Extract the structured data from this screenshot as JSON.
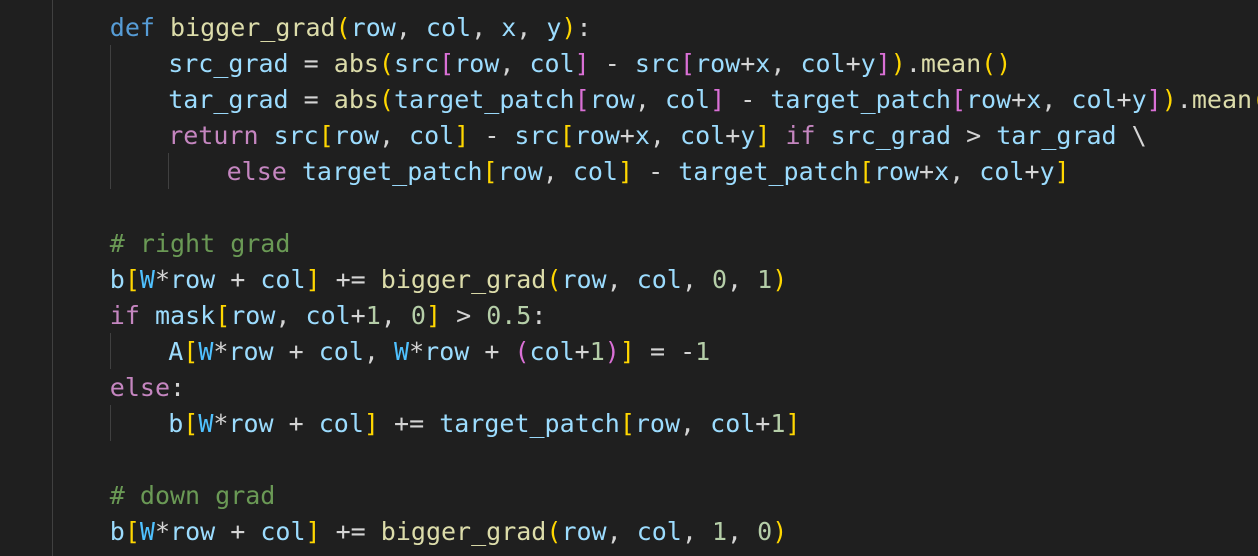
{
  "editor": {
    "language": "python",
    "colors": {
      "background": "#1f1f1f",
      "keyword": "#569cd6",
      "control": "#c586c0",
      "function": "#dcdcaa",
      "variable": "#9cdcfe",
      "constant": "#4fc1ff",
      "number": "#b5cea8",
      "comment": "#6a9955",
      "operator": "#d4d4d4",
      "bracket_1": "#ffd700",
      "bracket_2": "#da70d6",
      "bracket_3": "#179fff"
    },
    "lines": [
      {
        "indent": 2,
        "tokens": [
          [
            "keyword",
            "def"
          ],
          [
            "op",
            " "
          ],
          [
            "func",
            "bigger_grad"
          ],
          [
            "b1",
            "("
          ],
          [
            "var",
            "row"
          ],
          [
            "op",
            ", "
          ],
          [
            "var",
            "col"
          ],
          [
            "op",
            ", "
          ],
          [
            "var",
            "x"
          ],
          [
            "op",
            ", "
          ],
          [
            "var",
            "y"
          ],
          [
            "b1",
            ")"
          ],
          [
            "op",
            ":"
          ]
        ]
      },
      {
        "indent": 3,
        "tokens": [
          [
            "var",
            "src_grad"
          ],
          [
            "op",
            " = "
          ],
          [
            "func",
            "abs"
          ],
          [
            "b1",
            "("
          ],
          [
            "var",
            "src"
          ],
          [
            "b2",
            "["
          ],
          [
            "var",
            "row"
          ],
          [
            "op",
            ", "
          ],
          [
            "var",
            "col"
          ],
          [
            "b2",
            "]"
          ],
          [
            "op",
            " - "
          ],
          [
            "var",
            "src"
          ],
          [
            "b2",
            "["
          ],
          [
            "var",
            "row"
          ],
          [
            "op",
            "+"
          ],
          [
            "var",
            "x"
          ],
          [
            "op",
            ", "
          ],
          [
            "var",
            "col"
          ],
          [
            "op",
            "+"
          ],
          [
            "var",
            "y"
          ],
          [
            "b2",
            "]"
          ],
          [
            "b1",
            ")"
          ],
          [
            "op",
            "."
          ],
          [
            "func",
            "mean"
          ],
          [
            "b1",
            "()"
          ]
        ]
      },
      {
        "indent": 3,
        "tokens": [
          [
            "var",
            "tar_grad"
          ],
          [
            "op",
            " = "
          ],
          [
            "func",
            "abs"
          ],
          [
            "b1",
            "("
          ],
          [
            "var",
            "target_patch"
          ],
          [
            "b2",
            "["
          ],
          [
            "var",
            "row"
          ],
          [
            "op",
            ", "
          ],
          [
            "var",
            "col"
          ],
          [
            "b2",
            "]"
          ],
          [
            "op",
            " - "
          ],
          [
            "var",
            "target_patch"
          ],
          [
            "b2",
            "["
          ],
          [
            "var",
            "row"
          ],
          [
            "op",
            "+"
          ],
          [
            "var",
            "x"
          ],
          [
            "op",
            ", "
          ],
          [
            "var",
            "col"
          ],
          [
            "op",
            "+"
          ],
          [
            "var",
            "y"
          ],
          [
            "b2",
            "]"
          ],
          [
            "b1",
            ")"
          ],
          [
            "op",
            "."
          ],
          [
            "func",
            "mean"
          ],
          [
            "b1",
            "()"
          ]
        ]
      },
      {
        "indent": 3,
        "tokens": [
          [
            "control",
            "return"
          ],
          [
            "op",
            " "
          ],
          [
            "var",
            "src"
          ],
          [
            "b1",
            "["
          ],
          [
            "var",
            "row"
          ],
          [
            "op",
            ", "
          ],
          [
            "var",
            "col"
          ],
          [
            "b1",
            "]"
          ],
          [
            "op",
            " - "
          ],
          [
            "var",
            "src"
          ],
          [
            "b1",
            "["
          ],
          [
            "var",
            "row"
          ],
          [
            "op",
            "+"
          ],
          [
            "var",
            "x"
          ],
          [
            "op",
            ", "
          ],
          [
            "var",
            "col"
          ],
          [
            "op",
            "+"
          ],
          [
            "var",
            "y"
          ],
          [
            "b1",
            "]"
          ],
          [
            "op",
            " "
          ],
          [
            "control",
            "if"
          ],
          [
            "op",
            " "
          ],
          [
            "var",
            "src_grad"
          ],
          [
            "op",
            " > "
          ],
          [
            "var",
            "tar_grad"
          ],
          [
            "op",
            " \\"
          ]
        ]
      },
      {
        "indent": 4,
        "tokens": [
          [
            "control",
            "else"
          ],
          [
            "op",
            " "
          ],
          [
            "var",
            "target_patch"
          ],
          [
            "b1",
            "["
          ],
          [
            "var",
            "row"
          ],
          [
            "op",
            ", "
          ],
          [
            "var",
            "col"
          ],
          [
            "b1",
            "]"
          ],
          [
            "op",
            " - "
          ],
          [
            "var",
            "target_patch"
          ],
          [
            "b1",
            "["
          ],
          [
            "var",
            "row"
          ],
          [
            "op",
            "+"
          ],
          [
            "var",
            "x"
          ],
          [
            "op",
            ", "
          ],
          [
            "var",
            "col"
          ],
          [
            "op",
            "+"
          ],
          [
            "var",
            "y"
          ],
          [
            "b1",
            "]"
          ]
        ]
      },
      {
        "indent": 0,
        "tokens": []
      },
      {
        "indent": 2,
        "tokens": [
          [
            "comment",
            "# right grad"
          ]
        ]
      },
      {
        "indent": 2,
        "tokens": [
          [
            "var",
            "b"
          ],
          [
            "b1",
            "["
          ],
          [
            "const",
            "W"
          ],
          [
            "op",
            "*"
          ],
          [
            "var",
            "row"
          ],
          [
            "op",
            " + "
          ],
          [
            "var",
            "col"
          ],
          [
            "b1",
            "]"
          ],
          [
            "op",
            " += "
          ],
          [
            "func",
            "bigger_grad"
          ],
          [
            "b1",
            "("
          ],
          [
            "var",
            "row"
          ],
          [
            "op",
            ", "
          ],
          [
            "var",
            "col"
          ],
          [
            "op",
            ", "
          ],
          [
            "num",
            "0"
          ],
          [
            "op",
            ", "
          ],
          [
            "num",
            "1"
          ],
          [
            "b1",
            ")"
          ]
        ]
      },
      {
        "indent": 2,
        "tokens": [
          [
            "control",
            "if"
          ],
          [
            "op",
            " "
          ],
          [
            "var",
            "mask"
          ],
          [
            "b1",
            "["
          ],
          [
            "var",
            "row"
          ],
          [
            "op",
            ", "
          ],
          [
            "var",
            "col"
          ],
          [
            "op",
            "+"
          ],
          [
            "num",
            "1"
          ],
          [
            "op",
            ", "
          ],
          [
            "num",
            "0"
          ],
          [
            "b1",
            "]"
          ],
          [
            "op",
            " > "
          ],
          [
            "num",
            "0.5"
          ],
          [
            "op",
            ":"
          ]
        ]
      },
      {
        "indent": 3,
        "tokens": [
          [
            "var",
            "A"
          ],
          [
            "b1",
            "["
          ],
          [
            "const",
            "W"
          ],
          [
            "op",
            "*"
          ],
          [
            "var",
            "row"
          ],
          [
            "op",
            " + "
          ],
          [
            "var",
            "col"
          ],
          [
            "op",
            ", "
          ],
          [
            "const",
            "W"
          ],
          [
            "op",
            "*"
          ],
          [
            "var",
            "row"
          ],
          [
            "op",
            " + "
          ],
          [
            "b2",
            "("
          ],
          [
            "var",
            "col"
          ],
          [
            "op",
            "+"
          ],
          [
            "num",
            "1"
          ],
          [
            "b2",
            ")"
          ],
          [
            "b1",
            "]"
          ],
          [
            "op",
            " = "
          ],
          [
            "op",
            "-"
          ],
          [
            "num",
            "1"
          ]
        ]
      },
      {
        "indent": 2,
        "tokens": [
          [
            "control",
            "else"
          ],
          [
            "op",
            ":"
          ]
        ]
      },
      {
        "indent": 3,
        "tokens": [
          [
            "var",
            "b"
          ],
          [
            "b1",
            "["
          ],
          [
            "const",
            "W"
          ],
          [
            "op",
            "*"
          ],
          [
            "var",
            "row"
          ],
          [
            "op",
            " + "
          ],
          [
            "var",
            "col"
          ],
          [
            "b1",
            "]"
          ],
          [
            "op",
            " += "
          ],
          [
            "var",
            "target_patch"
          ],
          [
            "b1",
            "["
          ],
          [
            "var",
            "row"
          ],
          [
            "op",
            ", "
          ],
          [
            "var",
            "col"
          ],
          [
            "op",
            "+"
          ],
          [
            "num",
            "1"
          ],
          [
            "b1",
            "]"
          ]
        ]
      },
      {
        "indent": 0,
        "tokens": []
      },
      {
        "indent": 2,
        "tokens": [
          [
            "comment",
            "# down grad"
          ]
        ]
      },
      {
        "indent": 2,
        "tokens": [
          [
            "var",
            "b"
          ],
          [
            "b1",
            "["
          ],
          [
            "const",
            "W"
          ],
          [
            "op",
            "*"
          ],
          [
            "var",
            "row"
          ],
          [
            "op",
            " + "
          ],
          [
            "var",
            "col"
          ],
          [
            "b1",
            "]"
          ],
          [
            "op",
            " += "
          ],
          [
            "func",
            "bigger_grad"
          ],
          [
            "b1",
            "("
          ],
          [
            "var",
            "row"
          ],
          [
            "op",
            ", "
          ],
          [
            "var",
            "col"
          ],
          [
            "op",
            ", "
          ],
          [
            "num",
            "1"
          ],
          [
            "op",
            ", "
          ],
          [
            "num",
            "0"
          ],
          [
            "b1",
            ")"
          ]
        ]
      }
    ]
  }
}
